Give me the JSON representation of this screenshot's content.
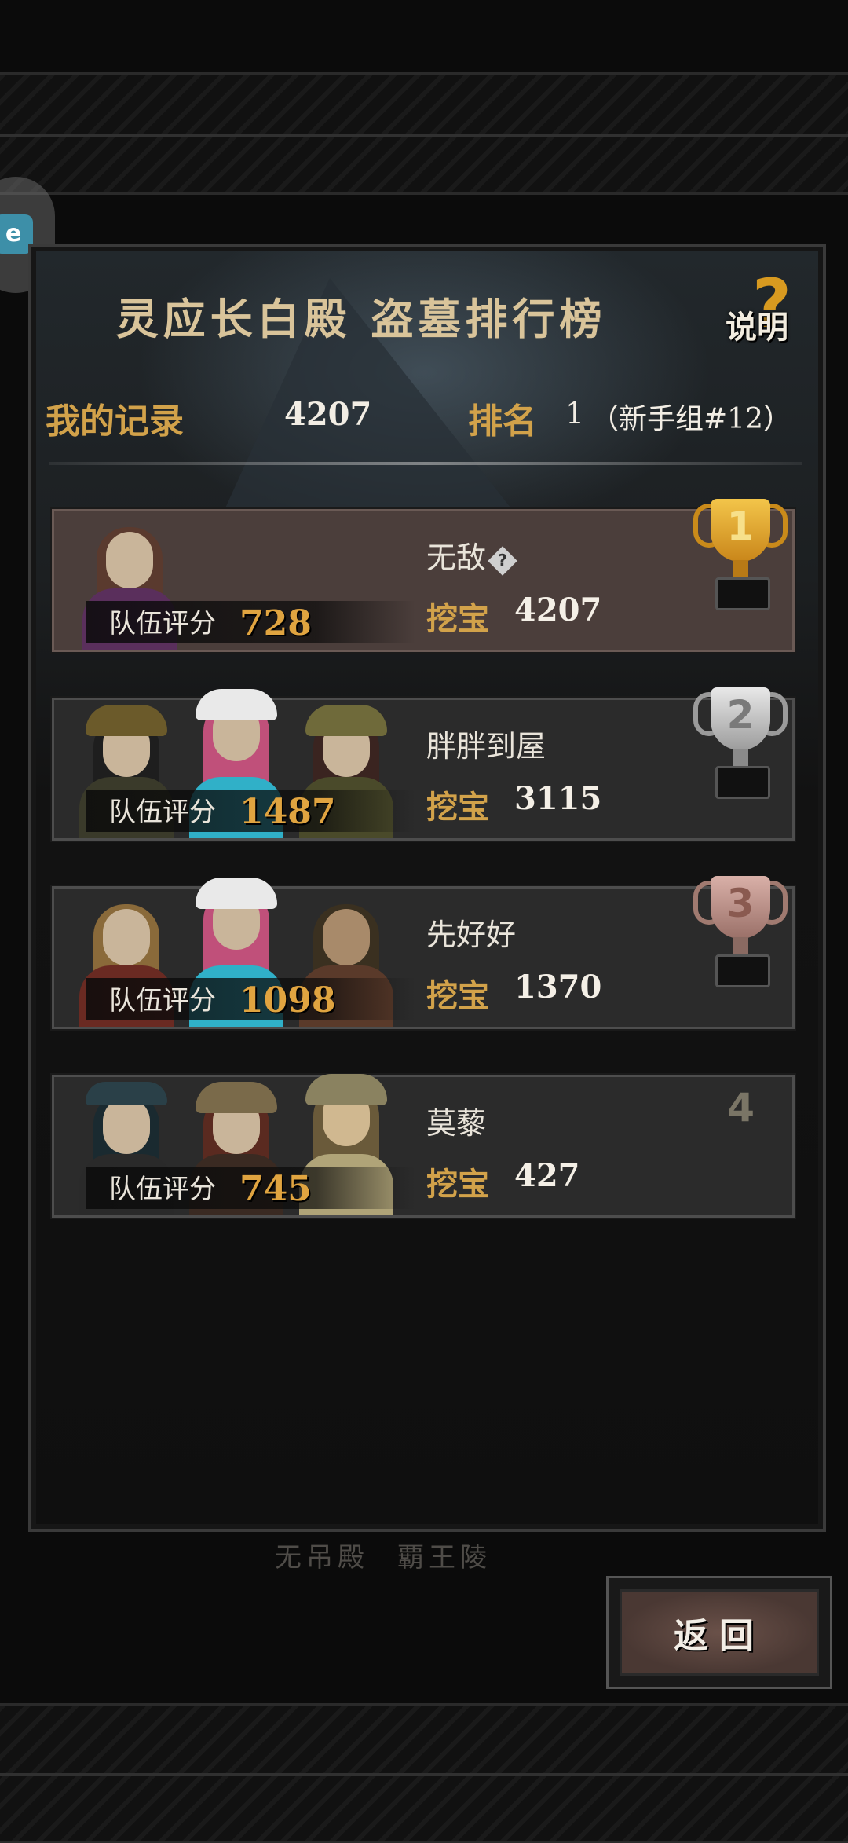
{
  "header": {
    "title": "灵应长白殿 盗墓排行榜",
    "help_label": "说明",
    "help_mark": "?"
  },
  "record": {
    "label": "我的记录",
    "value": "4207",
    "rank_label": "排名",
    "rank_value": "1",
    "group": "（新手组#12）"
  },
  "leaderboard": [
    {
      "rank": "1",
      "name": "无敌",
      "score_label": "队伍评分",
      "score": "728",
      "dig_label": "挖宝",
      "dig": "4207",
      "trophy": "gold"
    },
    {
      "rank": "2",
      "name": "胖胖到屋",
      "score_label": "队伍评分",
      "score": "1487",
      "dig_label": "挖宝",
      "dig": "3115",
      "trophy": "silver"
    },
    {
      "rank": "3",
      "name": "先好好",
      "score_label": "队伍评分",
      "score": "1098",
      "dig_label": "挖宝",
      "dig": "1370",
      "trophy": "bronze"
    },
    {
      "rank": "4",
      "name": "莫藜",
      "score_label": "队伍评分",
      "score": "745",
      "dig_label": "挖宝",
      "dig": "427",
      "trophy": "none"
    }
  ],
  "bottom_tabs": [
    "无吊殿",
    "覇王陵"
  ],
  "back_button": "返回",
  "colors": {
    "gold": "#d2a24a",
    "accent_orange": "#e0a440",
    "first_row": "#4b3e3b",
    "row": "#2b2b2b"
  },
  "icons": [
    "help-icon",
    "question-diamond-icon",
    "gold-trophy-icon",
    "silver-trophy-icon",
    "bronze-trophy-icon",
    "floating-app-icon"
  ]
}
